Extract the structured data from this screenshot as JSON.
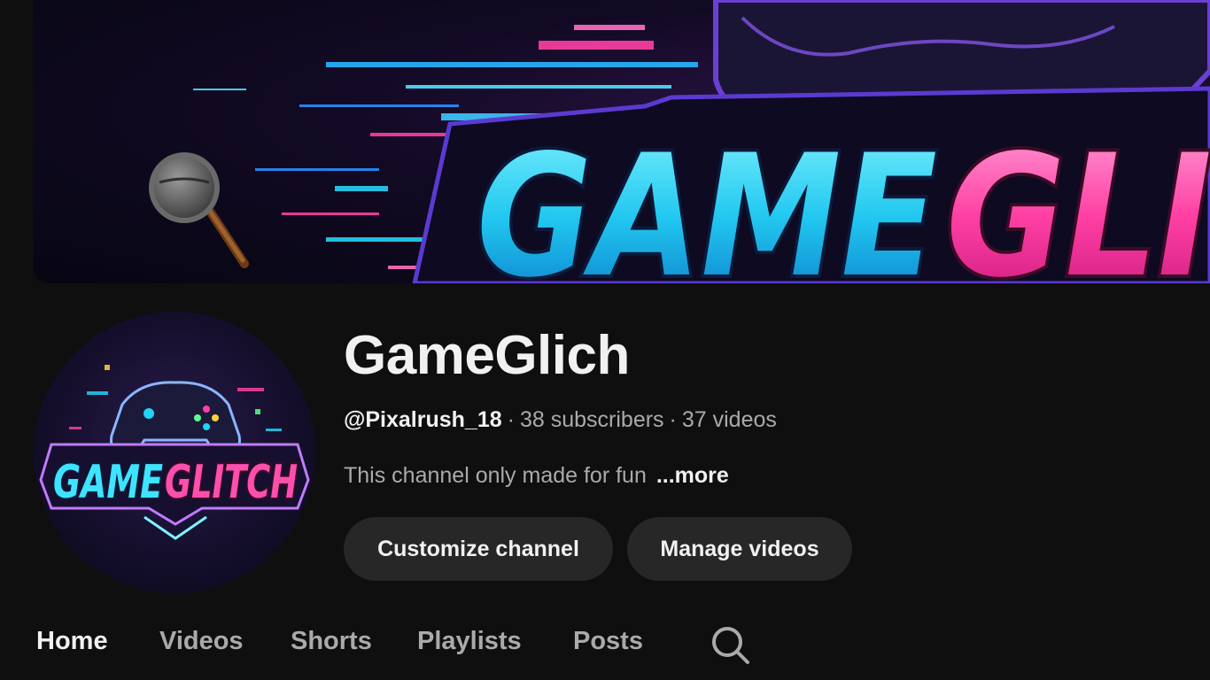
{
  "banner": {
    "wordmark": "GAMEGLI"
  },
  "channel": {
    "name": "GameGlich",
    "handle": "@Pixalrush_18",
    "subscribers": "38 subscribers",
    "videos": "37 videos",
    "separator": "·",
    "description": "This channel only made for fun",
    "more_label": "...more",
    "avatar_text": "GAMEGLITCH"
  },
  "actions": {
    "customize_label": "Customize channel",
    "manage_label": "Manage videos"
  },
  "tabs": [
    {
      "label": "Home",
      "active": true
    },
    {
      "label": "Videos"
    },
    {
      "label": "Shorts"
    },
    {
      "label": "Playlists"
    },
    {
      "label": "Posts"
    }
  ],
  "icons": {
    "banner_magnifier": "magnifier-icon",
    "tab_search": "search-icon"
  },
  "colors": {
    "background": "#0f0f0f",
    "button_bg": "#272727",
    "text_primary": "#f1f1f1",
    "text_secondary": "#aaaaaa",
    "glitch_cyan": "#22d3f5",
    "glitch_pink": "#ff3fa4"
  }
}
